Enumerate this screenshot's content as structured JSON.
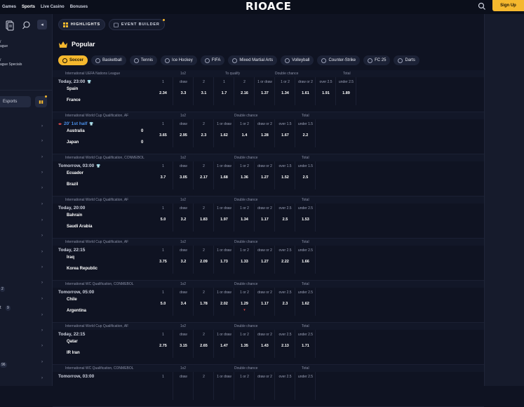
{
  "topnav": [
    "Games",
    "Sports",
    "Live Casino",
    "Bonuses"
  ],
  "logo": "RIOACE",
  "signup": "Sign Up",
  "sidebar": {
    "items": [
      {
        "label": "",
        "label2": "ague"
      },
      {
        "label": "",
        "label2": "ague Specials"
      }
    ],
    "esports": "Esports",
    "badges": [
      "2",
      "9",
      "96"
    ],
    "t_label": "t"
  },
  "tabs": [
    {
      "label": "HIGHLIGHTS"
    },
    {
      "label": "EVENT BUILDER"
    }
  ],
  "popular": "Popular",
  "sports": [
    "Soccer",
    "Basketball",
    "Tennis",
    "Ice Hockey",
    "FIFA",
    "Mixed Martial Arts",
    "Volleyball",
    "Counter-Strike",
    "FC 25",
    "Darts"
  ],
  "events": [
    {
      "league": "International   UEFA Nations League",
      "time": "Today, 23:00",
      "live": false,
      "home": "Spain",
      "away": "France",
      "score": [
        "",
        ""
      ],
      "heads": [
        "1x2",
        "To qualify",
        "Double chance",
        "Total"
      ],
      "labels": [
        "1",
        "draw",
        "2",
        "1",
        "2",
        "1 or draw",
        "1 or 2",
        "draw or 2",
        "over 2.5",
        "under 2.5"
      ],
      "odds": [
        "2.34",
        "3.3",
        "3.1",
        "1.7",
        "2.16",
        "1.37",
        "1.34",
        "1.61",
        "1.91",
        "1.89"
      ]
    },
    {
      "league": "International World Cup Qualification, AF",
      "time": "20' 1st half",
      "live": true,
      "home": "Australia",
      "away": "Japan",
      "score": [
        "0",
        "0"
      ],
      "heads": [
        "1x2",
        "Double chance",
        "Total"
      ],
      "labels": [
        "1",
        "draw",
        "2",
        "1 or draw",
        "1 or 2",
        "draw or 2",
        "over 1.5",
        "under 1.5"
      ],
      "odds": [
        "3.65",
        "2.95",
        "2.3",
        "1.62",
        "1.4",
        "1.28",
        "1.67",
        "2.2"
      ]
    },
    {
      "league": "International World Cup Qualification, CONMEBOL",
      "time": "Tomorrow, 03:00",
      "live": false,
      "home": "Ecuador",
      "away": "Brazil",
      "score": [
        "",
        ""
      ],
      "heads": [
        "1x2",
        "Double chance",
        "Total"
      ],
      "labels": [
        "1",
        "draw",
        "2",
        "1 or draw",
        "1 or 2",
        "draw or 2",
        "over 1.5",
        "under 1.5"
      ],
      "odds": [
        "3.7",
        "3.05",
        "2.17",
        "1.68",
        "1.36",
        "1.27",
        "1.52",
        "2.5"
      ]
    },
    {
      "league": "International World Cup Qualification, AF",
      "time": "Today, 20:00",
      "live": false,
      "home": "Bahrain",
      "away": "Saudi Arabia",
      "score": [
        "",
        ""
      ],
      "heads": [
        "1x2",
        "Double chance",
        "Total"
      ],
      "labels": [
        "1",
        "draw",
        "2",
        "1 or draw",
        "1 or 2",
        "draw or 2",
        "over 2.5",
        "under 2.5"
      ],
      "odds": [
        "5.0",
        "3.2",
        "1.83",
        "1.97",
        "1.34",
        "1.17",
        "2.5",
        "1.53"
      ]
    },
    {
      "league": "International World Cup Qualification, AF",
      "time": "Today, 22:15",
      "live": false,
      "home": "Iraq",
      "away": "Korea Republic",
      "score": [
        "",
        ""
      ],
      "heads": [
        "1x2",
        "Double chance",
        "Total"
      ],
      "labels": [
        "1",
        "draw",
        "2",
        "1 or draw",
        "1 or 2",
        "draw or 2",
        "over 2.5",
        "under 2.5"
      ],
      "odds": [
        "3.75",
        "3.2",
        "2.09",
        "1.73",
        "1.33",
        "1.27",
        "2.22",
        "1.66"
      ]
    },
    {
      "league": "International WC Qualification, CONMEBOL",
      "time": "Tomorrow, 05:00",
      "live": false,
      "home": "Chile",
      "away": "Argentina",
      "score": [
        "",
        ""
      ],
      "heads": [
        "1x2",
        "Double chance",
        "Total"
      ],
      "labels": [
        "1",
        "draw",
        "2",
        "1 or draw",
        "1 or 2",
        "draw or 2",
        "over 2.5",
        "under 2.5"
      ],
      "odds": [
        "5.0",
        "3.4",
        "1.78",
        "2.02",
        "1.29",
        "1.17",
        "2.3",
        "1.62"
      ],
      "down_index": 4
    },
    {
      "league": "International World Cup Qualification, AF",
      "time": "Today, 22:15",
      "live": false,
      "home": "Qatar",
      "away": "IR Iran",
      "score": [
        "",
        ""
      ],
      "heads": [
        "1x2",
        "Double chance",
        "Total"
      ],
      "labels": [
        "1",
        "draw",
        "2",
        "1 or draw",
        "1 or 2",
        "draw or 2",
        "over 2.5",
        "under 2.5"
      ],
      "odds": [
        "2.75",
        "3.15",
        "2.65",
        "1.47",
        "1.35",
        "1.43",
        "2.13",
        "1.71"
      ]
    },
    {
      "league": "International WC Qualification, CONMEBOL",
      "time": "Tomorrow, 03:00",
      "live": false,
      "home": "",
      "away": "",
      "score": [
        "",
        ""
      ],
      "heads": [
        "1x2",
        "Double chance",
        "Total"
      ],
      "labels": [
        "1",
        "draw",
        "2",
        "1 or draw",
        "1 or 2",
        "draw or 2",
        "over 2.5",
        "under 2.5"
      ],
      "odds": [
        "",
        "",
        "",
        "",
        "",
        "",
        "",
        ""
      ]
    }
  ]
}
